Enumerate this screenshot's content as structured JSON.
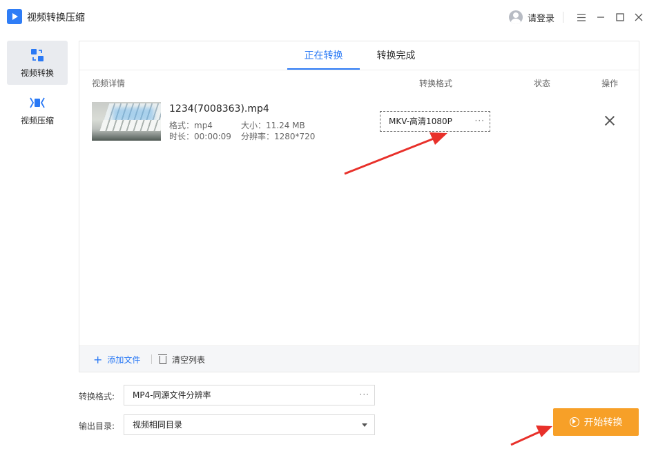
{
  "app": {
    "title": "视频转换压缩"
  },
  "header": {
    "login_label": "请登录"
  },
  "sidebar": {
    "items": [
      {
        "label": "视频转换",
        "active": true
      },
      {
        "label": "视频压缩",
        "active": false
      }
    ]
  },
  "tabs": [
    {
      "label": "正在转换",
      "active": true
    },
    {
      "label": "转换完成",
      "active": false
    }
  ],
  "table": {
    "columns": [
      "视频详情",
      "转换格式",
      "状态",
      "操作"
    ],
    "rows": [
      {
        "name": "1234(7008363).mp4",
        "format": "格式：mp4",
        "size": "大小：11.24 MB",
        "duration": "时长：00:00:09",
        "resolution": "分辨率：1280*720",
        "target_format": "MKV-高清1080P"
      }
    ]
  },
  "footer": {
    "add_label": "添加文件",
    "clear_label": "清空列表"
  },
  "form": {
    "format_label": "转换格式:",
    "format_value": "MP4-同源文件分辨率",
    "output_label": "输出目录:",
    "output_value": "视频相同目录"
  },
  "start_button": {
    "label": "开始转换"
  },
  "colors": {
    "accent": "#2a79f5",
    "start": "#f7a028",
    "annotation": "#e8302a"
  }
}
